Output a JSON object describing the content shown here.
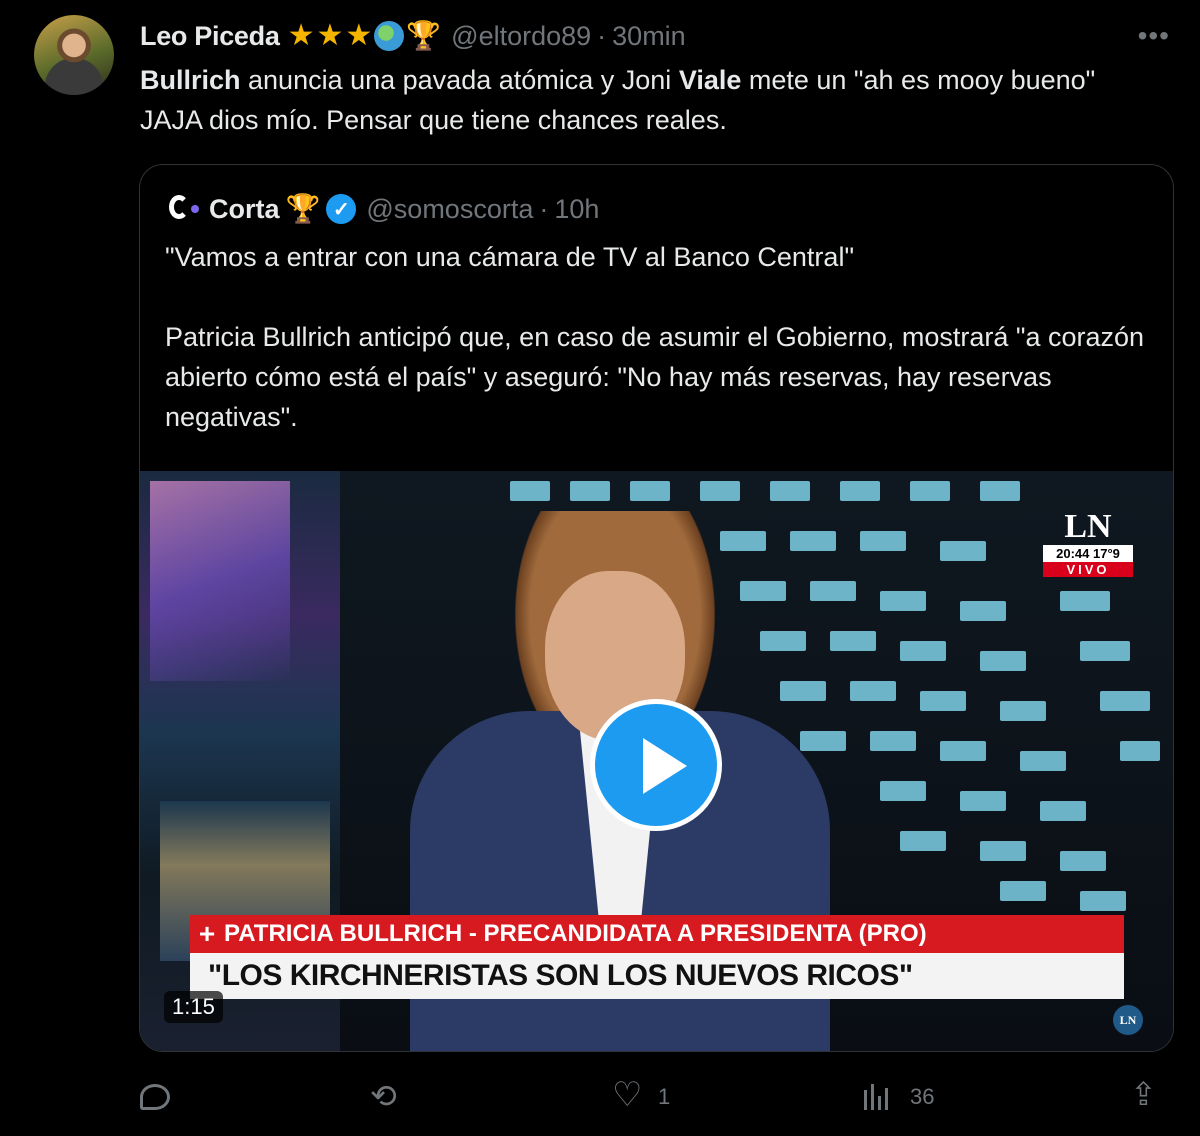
{
  "author": {
    "name": "Leo Piceda",
    "handle": "@eltordo89",
    "separator": "·",
    "time": "30min",
    "badge_emojis": [
      "star-icon",
      "star-icon",
      "star-icon",
      "globe-icon",
      "trophy-icon"
    ]
  },
  "more_label": "•••",
  "tweet_text": {
    "part1_bold": "Bullrich",
    "part2": " anuncia una pavada atómica y Joni ",
    "part3_bold": "Viale",
    "part4": " mete un \"ah es mooy bueno\" JAJA dios mío. Pensar que tiene chances reales."
  },
  "quoted": {
    "name": "Corta",
    "handle": "@somoscorta",
    "separator": "·",
    "time": "10h",
    "verified_mark": "✓",
    "trophy": "🏆",
    "line1": "\"Vamos a entrar con una cámara de TV al Banco Central\"",
    "line2": "Patricia Bullrich anticipó que, en caso de asumir el Gobierno, mostrará \"a corazón abierto cómo está el país\" y aseguró: \"No hay más reservas, hay reservas negativas\".",
    "video": {
      "channel_mark": "LN",
      "clock": "20:44  17°9",
      "live": "VIVO",
      "lower_third_plus": "+",
      "lower_third_name": "PATRICIA BULLRICH - PRECANDIDATA A PRESIDENTA (PRO)",
      "lower_third_quote": "\"LOS KIRCHNERISTAS SON LOS NUEVOS RICOS\"",
      "duration": "1:15",
      "corner_logo": "LN"
    }
  },
  "actions": {
    "replies": "",
    "retweets": "",
    "likes": "1",
    "views": "36"
  },
  "colors": {
    "background": "#000000",
    "text": "#e7e9ea",
    "muted": "#71767b",
    "accent": "#1d9bf0",
    "border": "#2f3336"
  }
}
